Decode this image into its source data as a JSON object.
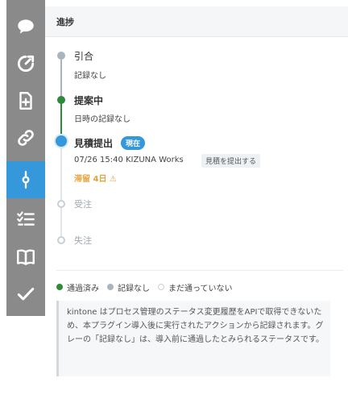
{
  "sidebar": {
    "items": [
      {
        "icon": "comment-icon",
        "active": false
      },
      {
        "icon": "dashboard-icon",
        "active": false
      },
      {
        "icon": "add-file-icon",
        "active": false
      },
      {
        "icon": "link-icon",
        "active": false
      },
      {
        "icon": "process-icon",
        "active": true
      },
      {
        "icon": "checklist-icon",
        "active": false
      },
      {
        "icon": "book-icon",
        "active": false
      },
      {
        "icon": "check-icon",
        "active": false
      }
    ],
    "active_color": "#3498db",
    "bar_color": "#8a8a8a"
  },
  "header": {
    "title": "進捗"
  },
  "timeline": {
    "steps": [
      {
        "label": "引合",
        "sub": "記録なし",
        "status": "no-record"
      },
      {
        "label": "提案中",
        "sub": "日時の記録なし",
        "status": "passed"
      },
      {
        "label": "見積提出",
        "badge": "現在",
        "detail": "07/26 15:40 KIZUNA Works",
        "action": "見積を提出する",
        "stay": "滞留 4日 ⚠",
        "status": "current"
      },
      {
        "label": "受注",
        "status": "not-reached"
      },
      {
        "label": "失注",
        "status": "not-reached"
      }
    ],
    "colors": {
      "passed": "#2e8b3a",
      "no_record": "#aab4be",
      "current": "#3498db",
      "not_reached": "#c8cfd6",
      "stay": "#e8a13a"
    }
  },
  "legend": {
    "items": [
      {
        "label": "通過済み",
        "color": "#2e8b3a"
      },
      {
        "label": "記録なし",
        "color": "#aab4be"
      },
      {
        "label": "まだ通っていない",
        "color": "#c8cfd6"
      }
    ]
  },
  "note": {
    "text": "kintone はプロセス管理のステータス変更履歴をAPIで取得できないため、本プラグイン導入後に実行されたアクションから記録されます。グレーの「記録なし」は、導入前に通過したとみられるステータスです。"
  }
}
